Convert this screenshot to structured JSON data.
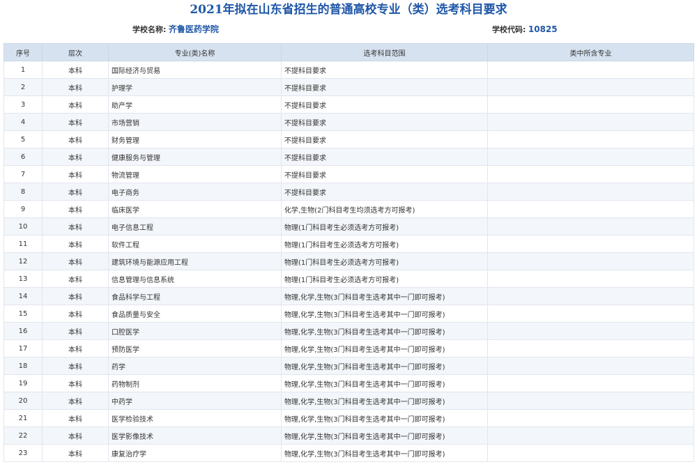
{
  "title": "2021年拟在山东省招生的普通高校专业（类）选考科目要求",
  "school": {
    "label": "学校名称:",
    "name": "齐鲁医药学院"
  },
  "code": {
    "label": "学校代码:",
    "value": "10825"
  },
  "columns": [
    "序号",
    "层次",
    "专业(类)名称",
    "选考科目范围",
    "类中所含专业"
  ],
  "rows": [
    {
      "no": "1",
      "level": "本科",
      "major": "国际经济与贸易",
      "req": "不提科目要求",
      "sub": ""
    },
    {
      "no": "2",
      "level": "本科",
      "major": "护理学",
      "req": "不提科目要求",
      "sub": ""
    },
    {
      "no": "3",
      "level": "本科",
      "major": "助产学",
      "req": "不提科目要求",
      "sub": ""
    },
    {
      "no": "4",
      "level": "本科",
      "major": "市场营销",
      "req": "不提科目要求",
      "sub": ""
    },
    {
      "no": "5",
      "level": "本科",
      "major": "财务管理",
      "req": "不提科目要求",
      "sub": ""
    },
    {
      "no": "6",
      "level": "本科",
      "major": "健康服务与管理",
      "req": "不提科目要求",
      "sub": ""
    },
    {
      "no": "7",
      "level": "本科",
      "major": "物流管理",
      "req": "不提科目要求",
      "sub": ""
    },
    {
      "no": "8",
      "level": "本科",
      "major": "电子商务",
      "req": "不提科目要求",
      "sub": ""
    },
    {
      "no": "9",
      "level": "本科",
      "major": "临床医学",
      "req": "化学,生物(2门科目考生均须选考方可报考)",
      "sub": ""
    },
    {
      "no": "10",
      "level": "本科",
      "major": "电子信息工程",
      "req": "物理(1门科目考生必须选考方可报考)",
      "sub": ""
    },
    {
      "no": "11",
      "level": "本科",
      "major": "软件工程",
      "req": "物理(1门科目考生必须选考方可报考)",
      "sub": ""
    },
    {
      "no": "12",
      "level": "本科",
      "major": "建筑环境与能源应用工程",
      "req": "物理(1门科目考生必须选考方可报考)",
      "sub": ""
    },
    {
      "no": "13",
      "level": "本科",
      "major": "信息管理与信息系统",
      "req": "物理(1门科目考生必须选考方可报考)",
      "sub": ""
    },
    {
      "no": "14",
      "level": "本科",
      "major": "食品科学与工程",
      "req": "物理,化学,生物(3门科目考生选考其中一门即可报考)",
      "sub": ""
    },
    {
      "no": "15",
      "level": "本科",
      "major": "食品质量与安全",
      "req": "物理,化学,生物(3门科目考生选考其中一门即可报考)",
      "sub": ""
    },
    {
      "no": "16",
      "level": "本科",
      "major": "口腔医学",
      "req": "物理,化学,生物(3门科目考生选考其中一门即可报考)",
      "sub": ""
    },
    {
      "no": "17",
      "level": "本科",
      "major": "预防医学",
      "req": "物理,化学,生物(3门科目考生选考其中一门即可报考)",
      "sub": ""
    },
    {
      "no": "18",
      "level": "本科",
      "major": "药学",
      "req": "物理,化学,生物(3门科目考生选考其中一门即可报考)",
      "sub": ""
    },
    {
      "no": "19",
      "level": "本科",
      "major": "药物制剂",
      "req": "物理,化学,生物(3门科目考生选考其中一门即可报考)",
      "sub": ""
    },
    {
      "no": "20",
      "level": "本科",
      "major": "中药学",
      "req": "物理,化学,生物(3门科目考生选考其中一门即可报考)",
      "sub": ""
    },
    {
      "no": "21",
      "level": "本科",
      "major": "医学检验技术",
      "req": "物理,化学,生物(3门科目考生选考其中一门即可报考)",
      "sub": ""
    },
    {
      "no": "22",
      "level": "本科",
      "major": "医学影像技术",
      "req": "物理,化学,生物(3门科目考生选考其中一门即可报考)",
      "sub": ""
    },
    {
      "no": "23",
      "level": "本科",
      "major": "康复治疗学",
      "req": "物理,化学,生物(3门科目考生选考其中一门即可报考)",
      "sub": ""
    }
  ],
  "colors": {
    "title": "#1f57a8",
    "header_bg": "#d6e2f0",
    "row_alt": "#f3f6fa"
  }
}
